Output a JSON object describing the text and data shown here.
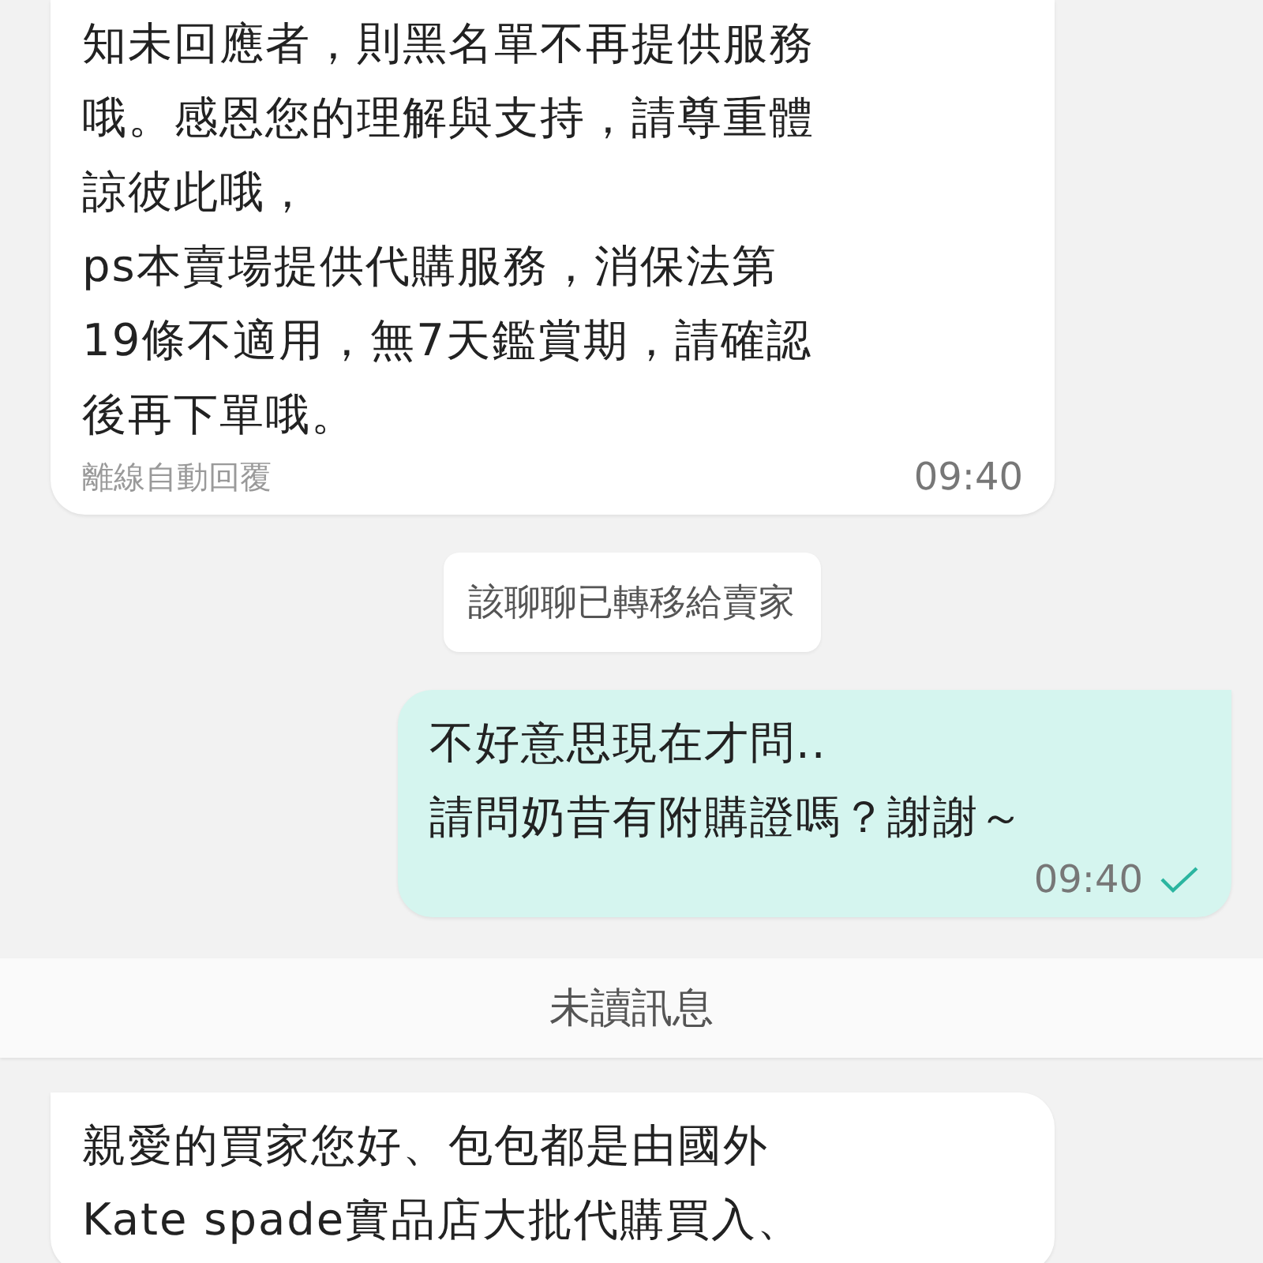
{
  "messages": [
    {
      "kind": "incoming",
      "text": "知未回應者，則黑名單不再提供服務哦。感恩您的理解與支持，請尊重體諒彼此哦，\nps本賣場提供代購服務，消保法第19條不適用，無7天鑑賞期，請確認後再下單哦。",
      "note": "離線自動回覆",
      "time": "09:40"
    },
    {
      "kind": "system",
      "text": "該聊聊已轉移給賣家"
    },
    {
      "kind": "outgoing",
      "text": "不好意思現在才問..\n請問奶昔有附購證嗎？謝謝～",
      "time": "09:40",
      "read": true,
      "tail": true
    },
    {
      "kind": "divider",
      "text": "未讀訊息"
    },
    {
      "kind": "incoming",
      "text": "親愛的買家您好、包包都是由國外Kate spade實品店大批代購買入、",
      "tail": true
    }
  ]
}
